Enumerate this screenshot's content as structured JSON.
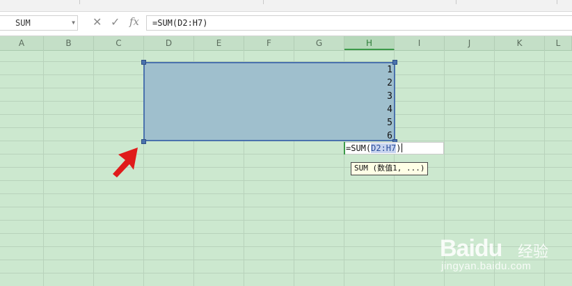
{
  "name_box": {
    "value": "SUM"
  },
  "formula_bar": {
    "fx_label": "fx",
    "cancel_glyph": "✕",
    "confirm_glyph": "✓",
    "value": "=SUM(D2:H7)"
  },
  "columns": [
    "A",
    "B",
    "C",
    "D",
    "E",
    "F",
    "G",
    "H",
    "I",
    "J",
    "K",
    "L"
  ],
  "selected_column": "H",
  "selection_values": [
    "1",
    "2",
    "3",
    "4",
    "5",
    "6"
  ],
  "edit_cell": {
    "prefix": "=SUM(",
    "range": "D2:H7",
    "suffix": ")"
  },
  "tooltip": {
    "text": "SUM (数值1, ...)"
  },
  "watermark": {
    "brand": "Baidu",
    "cn": "经验",
    "url": "jingyan.baidu.com"
  },
  "colors": {
    "sheet_bg": "#cce8cf",
    "selection_fill": "#9fbfcd",
    "selection_border": "#4a72ad",
    "arrow": "#e01b1b"
  },
  "icons": [
    "dropdown-icon",
    "cancel-icon",
    "confirm-icon",
    "fx-icon",
    "arrow-pointer-icon"
  ]
}
